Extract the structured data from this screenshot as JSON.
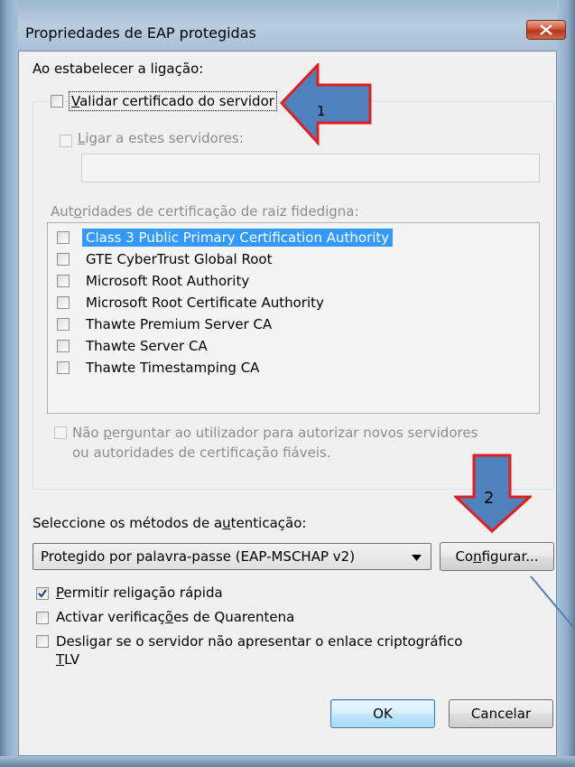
{
  "window": {
    "title": "Propriedades de EAP protegidas"
  },
  "connect": {
    "heading": "Ao estabelecer a ligação:",
    "validate_cert": {
      "pre": "",
      "acc": "V",
      "post": "alidar certificado do servidor",
      "checked": false
    },
    "connect_servers": {
      "pre": "",
      "acc": "L",
      "post": "igar a estes servidores:",
      "checked": false
    },
    "servers_value": "",
    "trusted_ca_label": {
      "pre": "Aut",
      "acc": "o",
      "post": "ridades de certificação de raiz fidedigna:"
    },
    "ca_list": [
      {
        "label": "Class 3 Public Primary Certification Authority",
        "checked": false,
        "selected": true
      },
      {
        "label": "GTE CyberTrust Global Root",
        "checked": false,
        "selected": false
      },
      {
        "label": "Microsoft Root Authority",
        "checked": false,
        "selected": false
      },
      {
        "label": "Microsoft Root Certificate Authority",
        "checked": false,
        "selected": false
      },
      {
        "label": "Thawte Premium Server CA",
        "checked": false,
        "selected": false
      },
      {
        "label": "Thawte Server CA",
        "checked": false,
        "selected": false
      },
      {
        "label": "Thawte Timestamping CA",
        "checked": false,
        "selected": false
      }
    ],
    "dont_prompt": {
      "line1_pre": "Não ",
      "acc": "p",
      "line1_post": "erguntar ao utilizador para autorizar novos servidores",
      "line2": "ou autoridades de certificação fiáveis.",
      "checked": false
    }
  },
  "auth": {
    "label": {
      "pre": "Seleccione os métodos de a",
      "acc": "u",
      "post": "tenticação:"
    },
    "method": "Protegido por palavra-passe (EAP-MSCHAP v2)",
    "configure_button": {
      "pre": "Co",
      "acc": "n",
      "post": "figurar..."
    }
  },
  "options": {
    "fast_reconnect": {
      "pre": "",
      "acc": "P",
      "post": "ermitir religação rápida",
      "checked": true
    },
    "quarantine": {
      "pre": "Activar verificaç",
      "acc": "õ",
      "post": "es de Quarentena",
      "checked": false
    },
    "disconnect_tlv": {
      "line1": "Desligar se o servidor não apresentar o enlace criptográfico",
      "line2_acc": "T",
      "line2_post": "LV",
      "checked": false
    }
  },
  "buttons": {
    "ok": "OK",
    "cancel": "Cancelar"
  },
  "annotations": {
    "arrow1_label": "1",
    "arrow2_label": "2",
    "arrow_color": "#4f81bd",
    "arrow_outline": "#e02020"
  }
}
